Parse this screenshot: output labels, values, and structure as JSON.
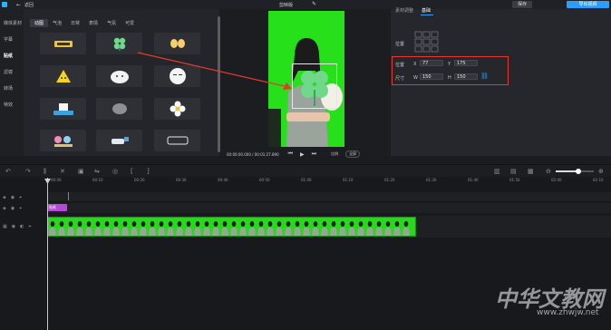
{
  "titlebar": {
    "back_label": "返回",
    "project_title": "剪映版",
    "publish_label": "保存",
    "export_label": "导出视频"
  },
  "left_nav": {
    "items": [
      "媒体素材",
      "字幕",
      "贴纸",
      "滤镜",
      "转场",
      "特效"
    ],
    "active_index": 2
  },
  "assets": {
    "tabs": [
      "动图",
      "气泡",
      "日常",
      "表情",
      "气氛",
      "可爱"
    ],
    "active_tab": 0,
    "stickers": [
      "sticker-text-hello",
      "clover-sticker",
      "hands-sticker",
      "yellow-blob-sticker",
      "white-cat-sticker",
      "face-sticker",
      "dog-tag-sticker",
      "grey-stone-sticker",
      "flower-sticker",
      "party-sticker",
      "dog-run-sticker",
      "balloon-text-sticker"
    ]
  },
  "preview": {
    "timecode": "00:00:00.000 / 00:01:27.890",
    "ratio_label": "比例",
    "fullscreen_label": "全屏"
  },
  "properties": {
    "tabs": [
      "素材调整",
      "基础"
    ],
    "active_tab": 1,
    "align_label": "位置",
    "position_label": "位置",
    "size_label": "尺寸",
    "x_label": "X",
    "x_value": "77",
    "y_label": "Y",
    "y_value": "175",
    "w_label": "W",
    "w_value": "150",
    "h_label": "H",
    "h_value": "150"
  },
  "timeline": {
    "ruler": [
      "00:00",
      "00:10",
      "00:20",
      "00:30",
      "00:40",
      "00:50",
      "01:00",
      "01:10",
      "01:20",
      "01:30",
      "01:40",
      "01:50",
      "02:00",
      "02:10"
    ],
    "sticker_clip_label": "贴纸"
  },
  "watermark": {
    "brand": "中华文教网",
    "url": "www.zhwjw.net"
  }
}
